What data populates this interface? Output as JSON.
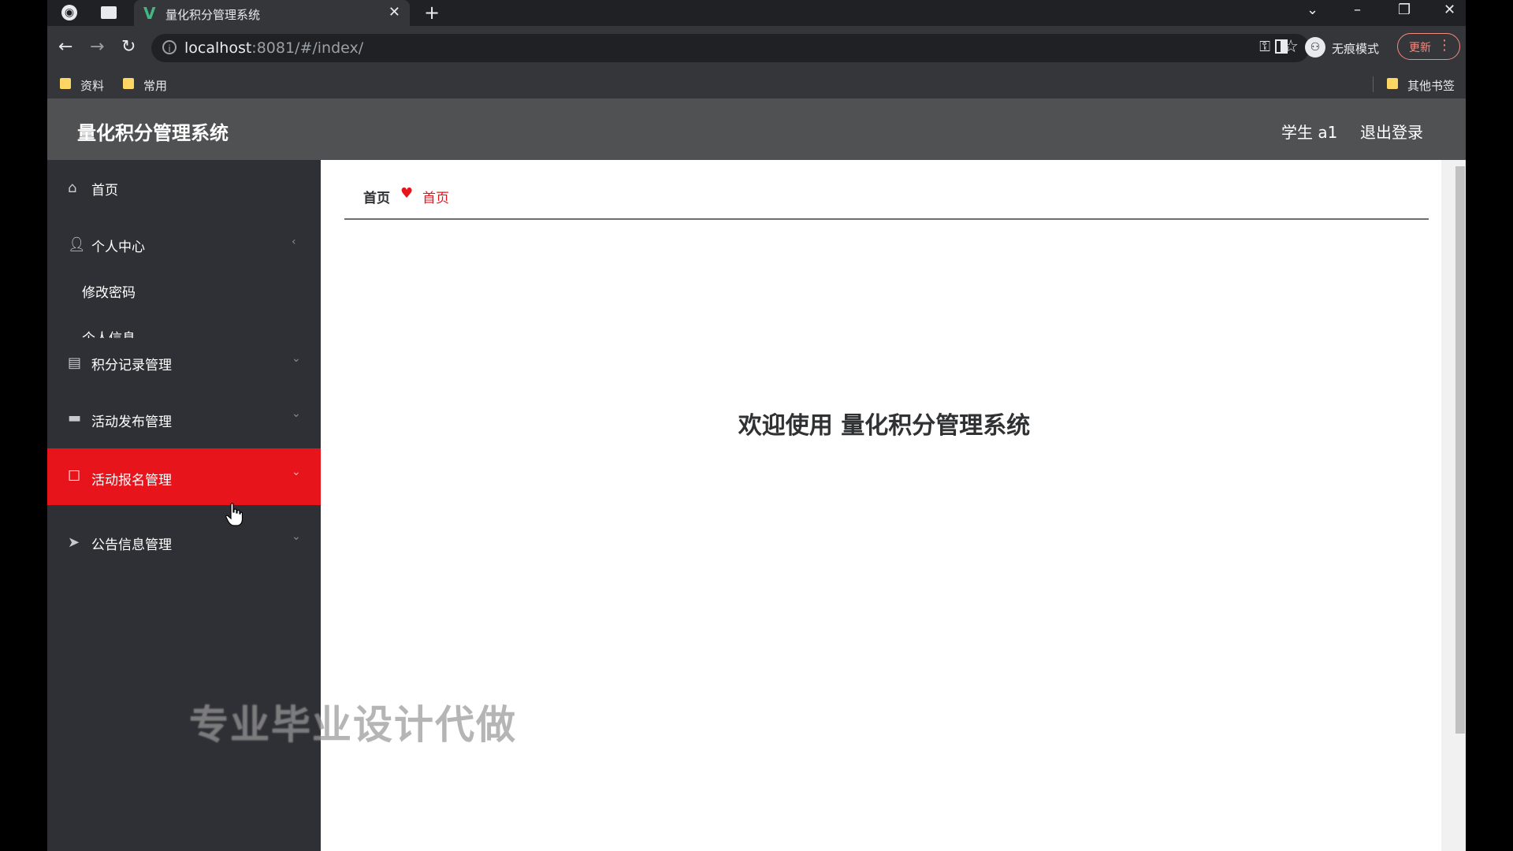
{
  "browser": {
    "tab": {
      "favicon": "V",
      "title": "量化积分管理系统"
    },
    "url": {
      "host": "localhost",
      "rest": ":8081/#/index/"
    },
    "incognito_label": "无痕模式",
    "update_label": "更新",
    "bookmarks": [
      {
        "label": "资料"
      },
      {
        "label": "常用"
      }
    ],
    "other_bookmarks": "其他书签"
  },
  "app": {
    "title": "量化积分管理系统",
    "user": "学生 a1",
    "logout": "退出登录"
  },
  "sidebar": {
    "items": [
      {
        "label": "首页",
        "icon": "home-icon"
      },
      {
        "label": "个人中心",
        "icon": "user-icon",
        "children": [
          {
            "label": "修改密码"
          },
          {
            "label": "个人信息"
          }
        ]
      },
      {
        "label": "积分记录管理",
        "icon": "clipboard-icon"
      },
      {
        "label": "活动发布管理",
        "icon": "monitor-icon"
      },
      {
        "label": "活动报名管理",
        "icon": "checkbox-icon",
        "active": true
      },
      {
        "label": "公告信息管理",
        "icon": "send-icon"
      }
    ]
  },
  "breadcrumb": {
    "home": "首页",
    "current": "首页"
  },
  "main": {
    "welcome": "欢迎使用 量化积分管理系统"
  },
  "watermark": "专业毕业设计代做",
  "colors": {
    "accent": "#e8141c",
    "sidebar_bg": "#2f3035",
    "header_bg": "#505153"
  }
}
